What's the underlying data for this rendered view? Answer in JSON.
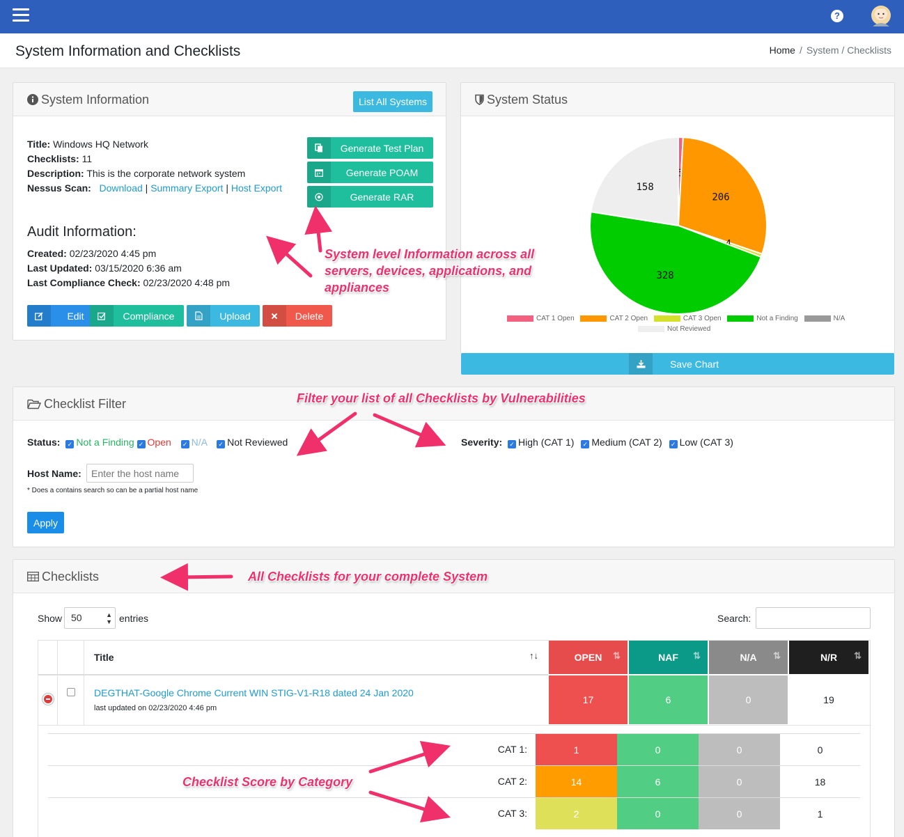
{
  "topbar": {
    "help_glyph": "?"
  },
  "page": {
    "title": "System Information and Checklists",
    "breadcrumb": {
      "home": "Home",
      "sep": "/",
      "current": "System / Checklists"
    }
  },
  "system_info": {
    "header": "System Information",
    "list_all_label": "List All Systems",
    "title_label": "Title:",
    "title_value": "Windows HQ Network",
    "checklists_label": "Checklists:",
    "checklists_value": "11",
    "description_label": "Description:",
    "description_value": "This is the corporate network system",
    "nessus_label": "Nessus Scan:",
    "nessus_links": [
      "Download",
      "Summary Export",
      "Host Export"
    ],
    "nessus_sep": "|",
    "actions": [
      "Generate Test Plan",
      "Generate POAM",
      "Generate RAR"
    ],
    "audit_title": "Audit Information:",
    "created_label": "Created:",
    "created_value": "02/23/2020 4:45 pm",
    "updated_label": "Last Updated:",
    "updated_value": "03/15/2020 6:36 am",
    "compliance_label": "Last Compliance Check:",
    "compliance_value": "02/23/2020 4:48 pm",
    "buttons": [
      "Edit",
      "Compliance",
      "Upload",
      "Delete"
    ]
  },
  "system_status": {
    "header": "System Status",
    "save_chart_label": "Save Chart"
  },
  "chart_data": {
    "type": "pie",
    "title": "",
    "series": [
      {
        "name": "CAT 1 Open",
        "value": 6,
        "color": "#f2617f"
      },
      {
        "name": "CAT 2 Open",
        "value": 206,
        "color": "#ff9800"
      },
      {
        "name": "CAT 3 Open",
        "value": 4,
        "color": "#d4e02a"
      },
      {
        "name": "Not a Finding",
        "value": 328,
        "color": "#00cc00"
      },
      {
        "name": "N/A",
        "value": 0,
        "color": "#999999"
      },
      {
        "name": "Not Reviewed",
        "value": 158,
        "color": "#eeeeee"
      }
    ],
    "legend": "bottom"
  },
  "filter": {
    "header": "Checklist Filter",
    "status_label": "Status:",
    "status_opts": [
      "Not a Finding",
      "Open",
      "N/A",
      "Not Reviewed"
    ],
    "severity_label": "Severity:",
    "severity_opts": [
      "High (CAT 1)",
      "Medium (CAT 2)",
      "Low (CAT 3)"
    ],
    "host_label": "Host Name:",
    "host_placeholder": "Enter the host name",
    "host_hint": "* Does a contains search so can be a partial host name",
    "apply_label": "Apply",
    "colors": {
      "naf": "#28a745",
      "open": "#dc3545",
      "na": "#7fb0d8"
    }
  },
  "checklists": {
    "header": "Checklists",
    "show_label": "Show",
    "entries_value": "50",
    "entries_label": "entries",
    "search_label": "Search:",
    "columns": [
      "Title",
      "OPEN",
      "NAF",
      "N/A",
      "N/R"
    ],
    "row": {
      "title": "DEGTHAT-Google Chrome Current WIN STIG-V1-R18 dated 24 Jan 2020",
      "updated": "last updated on 02/23/2020 4:46 pm",
      "open": "17",
      "naf": "6",
      "na": "0",
      "nr": "19"
    },
    "cats": [
      {
        "label": "CAT 1:",
        "open": "1",
        "naf": "0",
        "na": "0",
        "nr": "0"
      },
      {
        "label": "CAT 2:",
        "open": "14",
        "naf": "6",
        "na": "0",
        "nr": "18"
      },
      {
        "label": "CAT 3:",
        "open": "2",
        "naf": "0",
        "na": "0",
        "nr": "1"
      }
    ]
  },
  "annotations": {
    "system_level": [
      "System level Information across all",
      "servers, devices, applications, and",
      "appliances"
    ],
    "filter": "Filter your list of all Checklists by Vulnerabilities",
    "all_checklists": "All Checklists for your complete System",
    "score": "Checklist Score by Category"
  }
}
